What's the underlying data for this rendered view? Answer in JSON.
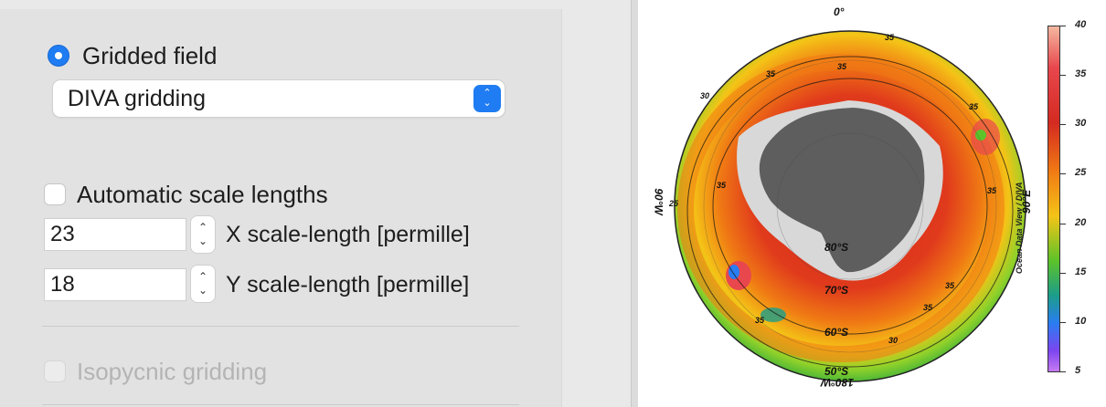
{
  "settings": {
    "gridded_field_label": "Gridded field",
    "gridding_method": "DIVA gridding",
    "auto_scale_label": "Automatic scale lengths",
    "x_scale_value": "23",
    "x_scale_label": "X scale-length [permille]",
    "y_scale_value": "18",
    "y_scale_label": "Y scale-length [permille]",
    "isopycnic_label": "Isopycnic gridding",
    "gridded_field_selected": true,
    "auto_scale_checked": false,
    "isopycnic_enabled": false
  },
  "map": {
    "lon_top": "0°",
    "lon_left": "90°W",
    "lon_right": "90°E",
    "lon_bottom": "180°W",
    "lat_80": "80°S",
    "lat_70": "70°S",
    "lat_60": "60°S",
    "lat_50": "50°S",
    "contour_labels": [
      "35",
      "35",
      "35",
      "35",
      "35",
      "35",
      "35",
      "35",
      "30",
      "25",
      "35",
      "30"
    ],
    "credit": "Ocean Data View / DIVA",
    "colorbar_ticks": [
      "40",
      "35",
      "30",
      "25",
      "20",
      "15",
      "10",
      "5"
    ],
    "colors": {
      "ocean_warm": "#d42a20",
      "ocean_mid": "#f07a14",
      "ocean_cool": "#f4c417",
      "ocean_cold": "#5cc32a",
      "land": "#5e5e5e",
      "ice": "#cfcfcf",
      "accent": "#1f7cf2"
    }
  }
}
